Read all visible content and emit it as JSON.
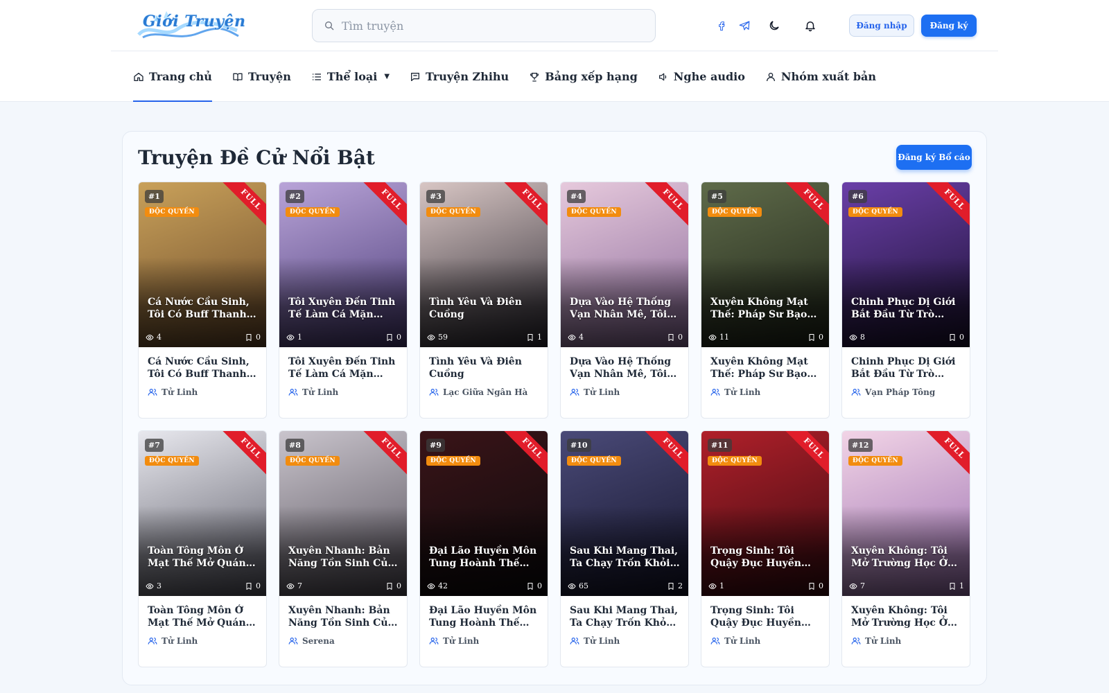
{
  "header": {
    "logo_text": "Giới Truyện",
    "search_placeholder": "Tìm truyện",
    "login_label": "Đăng nhập",
    "register_label": "Đăng ký"
  },
  "nav": [
    {
      "label": "Trang chủ",
      "icon": "home-icon",
      "active": true
    },
    {
      "label": "Truyện",
      "icon": "book-icon"
    },
    {
      "label": "Thể loại",
      "icon": "list-icon",
      "caret": "▼"
    },
    {
      "label": "Truyện Zhihu",
      "icon": "chat-icon"
    },
    {
      "label": "Bảng xếp hạng",
      "icon": "trophy-icon"
    },
    {
      "label": "Nghe audio",
      "icon": "speaker-icon"
    },
    {
      "label": "Nhóm xuất bản",
      "icon": "user-icon"
    }
  ],
  "section": {
    "title": "Truyện Đề Cử Nổi Bật",
    "report_button": "Đăng ký Bổ cáo"
  },
  "badges": {
    "exclusive": "ĐỘC QUYỀN",
    "full": "FULL"
  },
  "colors": {
    "accent": "#1d6ff2",
    "exclusive": "#f28c0f",
    "full_ribbon": "#e11d2a"
  },
  "stories": [
    {
      "rank": "#1",
      "cover_title": "Cá Nước Cầu Sinh, Tôi Có Buff Thanh Máu T...",
      "title": "Cá Nước Cầu Sinh, Tôi Có Buff Thanh Máu Tr...",
      "views": "4",
      "bookmarks": "0",
      "author": "Tử Linh",
      "c1": "#c9a15a",
      "c2": "#6b4a2a"
    },
    {
      "rank": "#2",
      "cover_title": "Tôi Xuyên Đến Tinh Tế Làm Cá Mặn Siêu Cấp",
      "title": "Tôi Xuyên Đến Tinh Tế Làm Cá Mặn Siêu Cấp",
      "views": "1",
      "bookmarks": "0",
      "author": "Tử Linh",
      "c1": "#b9a4d8",
      "c2": "#4a3b78"
    },
    {
      "rank": "#3",
      "cover_title": "Tình Yêu Và Điên Cuồng",
      "title": "Tình Yêu Và Điên Cuồng",
      "views": "59",
      "bookmarks": "1",
      "author": "Lạc Giữa Ngân Hà",
      "c1": "#d8c6c4",
      "c2": "#2d2a33"
    },
    {
      "rank": "#4",
      "cover_title": "Dựa Vào Hệ Thống Vạn Nhân Mê, Tôi Xưng B...",
      "title": "Dựa Vào Hệ Thống Vạn Nhân Mê, Tôi Xưng Bá...",
      "views": "4",
      "bookmarks": "0",
      "author": "Tử Linh",
      "c1": "#e6c9dc",
      "c2": "#8a6a9a"
    },
    {
      "rank": "#5",
      "cover_title": "Xuyên Không Mạt Thế: Pháp Sư Bạo Nộ",
      "title": "Xuyên Không Mạt Thế: Pháp Sư Bạo Nộ",
      "views": "11",
      "bookmarks": "0",
      "author": "Tử Linh",
      "c1": "#5f6b4a",
      "c2": "#1e2418"
    },
    {
      "rank": "#6",
      "cover_title": "Chinh Phục Dị Giới Bắt Đầu Từ Trò Chơi",
      "title": "Chinh Phục Dị Giới Bắt Đầu Từ Trò Chơi",
      "views": "8",
      "bookmarks": "0",
      "author": "Vạn Pháp Tông",
      "c1": "#6a3fa8",
      "c2": "#1a1030"
    },
    {
      "rank": "#7",
      "cover_title": "Toàn Tông Môn Ở Mạt Thế Mở Quán Trọ",
      "title": "Toàn Tông Môn Ở Mạt Thế Mở Quán Trọ",
      "views": "3",
      "bookmarks": "0",
      "author": "Tử Linh",
      "c1": "#e8e8ee",
      "c2": "#5a5a66"
    },
    {
      "rank": "#8",
      "cover_title": "Xuyên Nhanh: Bản Năng Tồn Sinh Của Bug",
      "title": "Xuyên Nhanh: Bản Năng Tồn Sinh Của Bug",
      "views": "7",
      "bookmarks": "0",
      "author": "Serena",
      "c1": "#c9c4cc",
      "c2": "#55505a"
    },
    {
      "rank": "#9",
      "cover_title": "Đại Lão Huyền Môn Tung Hoành Thế Giới...",
      "title": "Đại Lão Huyền Môn Tung Hoành Thế Giới...",
      "views": "42",
      "bookmarks": "0",
      "author": "Tử Linh",
      "c1": "#3a1418",
      "c2": "#0c0a0c"
    },
    {
      "rank": "#10",
      "cover_title": "Sau Khi Mang Thai, Ta Chạy Trốn Khỏi Long...",
      "title": "Sau Khi Mang Thai, Ta Chạy Trốn Khỏi Long...",
      "views": "65",
      "bookmarks": "2",
      "author": "Tử Linh",
      "c1": "#4a4a78",
      "c2": "#14142a"
    },
    {
      "rank": "#11",
      "cover_title": "Trọng Sinh: Tôi Quậy Đục Huyền Môn",
      "title": "Trọng Sinh: Tôi Quậy Đục Huyền Môn",
      "views": "1",
      "bookmarks": "0",
      "author": "Tử Linh",
      "c1": "#b0202a",
      "c2": "#3a0a10"
    },
    {
      "rank": "#12",
      "cover_title": "Xuyên Không: Tôi Mở Trường Học Ở Tinh Tế",
      "title": "Xuyên Không: Tôi Mở Trường Học Ở Tinh Tế",
      "views": "7",
      "bookmarks": "1",
      "author": "Tử Linh",
      "c1": "#f2d4e6",
      "c2": "#9a6fb0"
    }
  ]
}
